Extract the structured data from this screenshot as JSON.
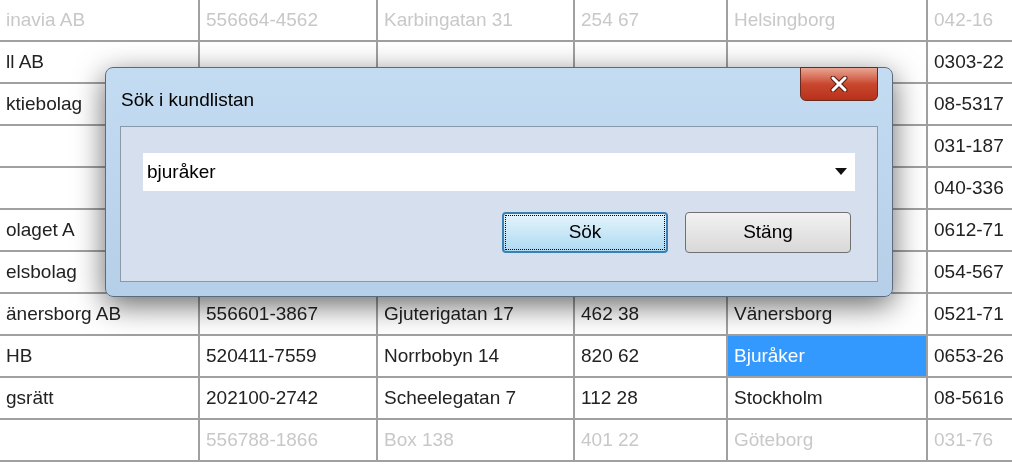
{
  "table": {
    "rows": [
      {
        "kind": "full",
        "dimmed": true,
        "cells": [
          {
            "text": "inavia AB",
            "selected": false
          },
          {
            "text": "556664-4562",
            "selected": false
          },
          {
            "text": "Karbingatan 31",
            "selected": false
          },
          {
            "text": "254 67",
            "selected": false
          },
          {
            "text": "Helsingborg",
            "selected": false
          },
          {
            "text": "042-16",
            "selected": false
          }
        ]
      },
      {
        "kind": "covered",
        "dimmed": false,
        "cells": [
          {
            "text": "ll AB",
            "selected": false
          },
          {
            "text": "0303-22",
            "selected": false
          }
        ]
      },
      {
        "kind": "covered",
        "dimmed": false,
        "cells": [
          {
            "text": "ktiebolag",
            "selected": false
          },
          {
            "text": "08-5317",
            "selected": false
          }
        ]
      },
      {
        "kind": "covered_blank",
        "dimmed": false,
        "cells": [
          {
            "text": "031-187",
            "selected": false
          }
        ]
      },
      {
        "kind": "covered_blank",
        "dimmed": false,
        "cells": [
          {
            "text": "040-336",
            "selected": false
          }
        ]
      },
      {
        "kind": "covered",
        "dimmed": false,
        "cells": [
          {
            "text": "olaget A",
            "selected": false
          },
          {
            "text": "0612-71",
            "selected": false
          }
        ]
      },
      {
        "kind": "covered",
        "dimmed": false,
        "cells": [
          {
            "text": "elsbolag",
            "selected": false
          },
          {
            "text": "054-567",
            "selected": false
          }
        ]
      },
      {
        "kind": "full",
        "dimmed": false,
        "cells": [
          {
            "text": "änersborg AB",
            "selected": false
          },
          {
            "text": "556601-3867",
            "selected": false
          },
          {
            "text": "Gjuterigatan 17",
            "selected": false
          },
          {
            "text": "462 38",
            "selected": false
          },
          {
            "text": "Vänersborg",
            "selected": false
          },
          {
            "text": "0521-71",
            "selected": false
          }
        ]
      },
      {
        "kind": "full",
        "dimmed": false,
        "cells": [
          {
            "text": "HB",
            "selected": false
          },
          {
            "text": "520411-7559",
            "selected": false
          },
          {
            "text": "Norrbobyn 14",
            "selected": false
          },
          {
            "text": "820 62",
            "selected": false
          },
          {
            "text": "Bjuråker",
            "selected": true
          },
          {
            "text": "0653-26",
            "selected": false
          }
        ]
      },
      {
        "kind": "full",
        "dimmed": false,
        "cells": [
          {
            "text": "gsrätt",
            "selected": false
          },
          {
            "text": "202100-2742",
            "selected": false
          },
          {
            "text": "Scheelegatan 7",
            "selected": false
          },
          {
            "text": "112 28",
            "selected": false
          },
          {
            "text": "Stockholm",
            "selected": false
          },
          {
            "text": "08-5616",
            "selected": false
          }
        ]
      },
      {
        "kind": "full",
        "dimmed": true,
        "cells": [
          {
            "selected": false
          },
          {
            "text": "556788-1866",
            "selected": false
          },
          {
            "text": "Box 138",
            "selected": false
          },
          {
            "text": "401 22",
            "selected": false
          },
          {
            "text": "Göteborg",
            "selected": false
          },
          {
            "text": "031-76",
            "selected": false
          }
        ]
      }
    ]
  },
  "dialog": {
    "title": "Sök i kundlistan",
    "search": {
      "value": "bjuråker"
    },
    "buttons": [
      {
        "label": "Sök",
        "focused": true
      },
      {
        "label": "Stäng",
        "focused": false
      }
    ]
  }
}
